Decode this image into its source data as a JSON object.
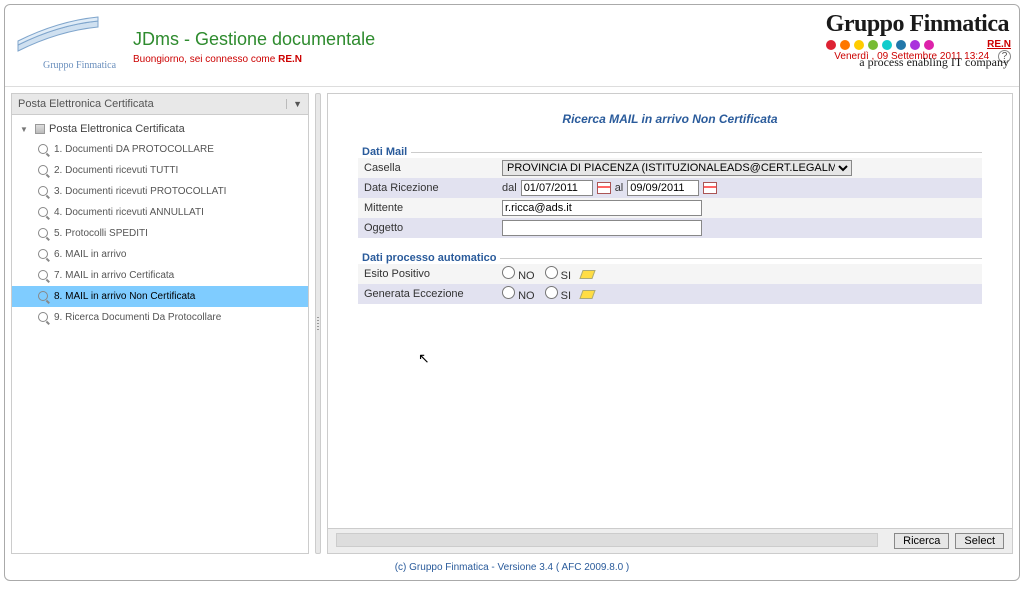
{
  "header": {
    "logo_signature": "Gruppo Finmatica",
    "app_title": "JDms - Gestione documentale",
    "greeting_prefix": "Buongiorno, sei connesso come ",
    "user_code": "RE.N",
    "user_link": "RE.N",
    "date_line": "Venerdì , 09 Settembre 2011 13:24",
    "help": "?"
  },
  "brand": {
    "title": "Gruppo Finmatica",
    "tagline": "a process enabling IT company"
  },
  "sidebar": {
    "dropdown": "Posta Elettronica Certificata",
    "root": "Posta Elettronica Certificata",
    "items": [
      {
        "label": "1. Documenti DA PROTOCOLLARE"
      },
      {
        "label": "2. Documenti ricevuti TUTTI"
      },
      {
        "label": "3. Documenti ricevuti PROTOCOLLATI"
      },
      {
        "label": "4. Documenti ricevuti ANNULLATI"
      },
      {
        "label": "5. Protocolli SPEDITI"
      },
      {
        "label": "6. MAIL in arrivo"
      },
      {
        "label": "7. MAIL in arrivo Certificata"
      },
      {
        "label": "8. MAIL in arrivo Non Certificata",
        "selected": true
      },
      {
        "label": "9. Ricerca Documenti Da Protocollare"
      }
    ]
  },
  "search": {
    "title": "Ricerca MAIL in arrivo Non Certificata",
    "fieldset1_legend": "Dati Mail",
    "casella_label": "Casella",
    "casella_value": "PROVINCIA DI PIACENZA (ISTITUZIONALEADS@CERT.LEGALMAIL.IT)",
    "data_ricezione_label": "Data Ricezione",
    "dal": "dal",
    "date_from": "01/07/2011",
    "al": "al",
    "date_to": "09/09/2011",
    "mittente_label": "Mittente",
    "mittente_value": "r.ricca@ads.it",
    "oggetto_label": "Oggetto",
    "oggetto_value": "",
    "fieldset2_legend": "Dati processo automatico",
    "esito_label": "Esito Positivo",
    "eccezione_label": "Generata Eccezione",
    "no": "NO",
    "si": "SI",
    "btn_ricerca": "Ricerca",
    "btn_select": "Select"
  },
  "footer": "(c) Gruppo Finmatica - Versione 3.4  ( AFC 2009.8.0 )"
}
